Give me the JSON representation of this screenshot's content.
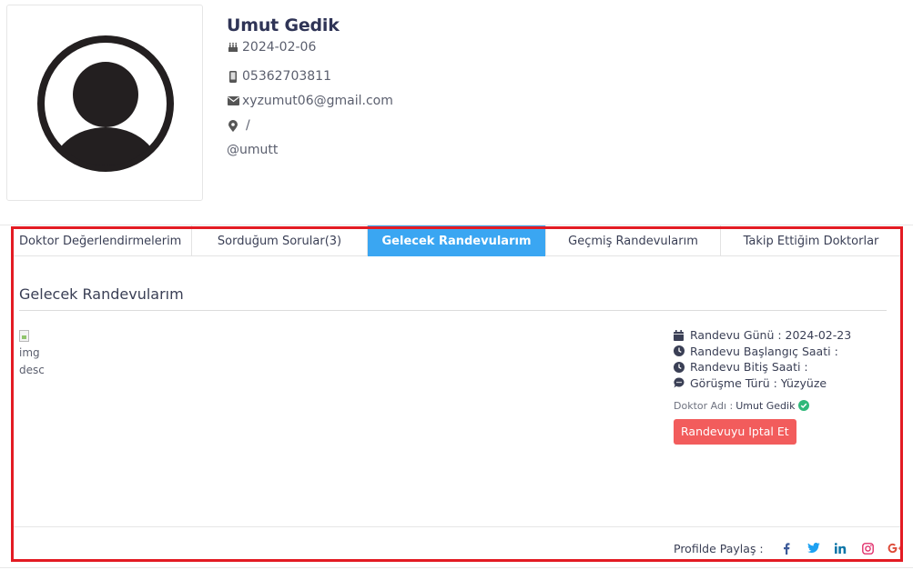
{
  "profile": {
    "name": "Umut Gedik",
    "birthdate": "2024-02-06",
    "phone": "05362703811",
    "email": "xyzumut06@gmail.com",
    "location": "/",
    "username": "@umutt"
  },
  "tabs": [
    {
      "label": "Doktor Değerlendirmelerim",
      "active": false
    },
    {
      "label": "Sorduğum Sorular(3)",
      "active": false
    },
    {
      "label": "Gelecek Randevularım",
      "active": true
    },
    {
      "label": "Geçmiş Randevularım",
      "active": false
    },
    {
      "label": "Takip Ettiğim Doktorlar",
      "active": false
    }
  ],
  "section": {
    "title": "Gelecek Randevularım"
  },
  "image_alt": {
    "line1": "img",
    "line2": "desc"
  },
  "appointment": {
    "day": "Randevu Günü : 2024-02-23",
    "start": "Randevu Başlangıç Saati :",
    "end": "Randevu Bitiş Saati :",
    "type": "Görüşme Türü : Yüzyüze",
    "doctor_label": "Doktor Adı :",
    "doctor_name": "Umut Gedik",
    "cancel_label": "Randevuyu Iptal Et"
  },
  "share": {
    "label": "Profilde Paylaş :",
    "networks": [
      "facebook-icon",
      "twitter-icon",
      "linkedin-icon",
      "instagram-icon",
      "google-plus-icon"
    ]
  },
  "colors": {
    "active_tab": "#3aa6f2",
    "cancel_button": "#f25c5c",
    "highlight_frame": "#e31b23",
    "verified": "#2fb87a",
    "facebook": "#3b5998",
    "twitter": "#1da1f2",
    "linkedin": "#0e76a8",
    "instagram": "#e1306c",
    "google": "#dd4b39"
  }
}
